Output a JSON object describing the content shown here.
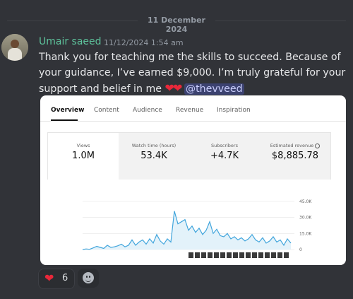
{
  "date_divider": "11 December 2024",
  "message": {
    "author": "Umair saeed",
    "timestamp": "11/12/2024 1:54 am",
    "text": "Thank you for teaching me the skills to succeed. Because of your guidance, I’ve earned $9,000. I’m truly grateful for your support and belief in me",
    "hearts": "❤❤",
    "mention": "@thevveed"
  },
  "analytics": {
    "tabs": [
      "Overview",
      "Content",
      "Audience",
      "Revenue",
      "Inspiration"
    ],
    "active_tab": "Overview",
    "metrics": [
      {
        "label": "Views",
        "value": "1.0M"
      },
      {
        "label": "Watch time (hours)",
        "value": "53.4K"
      },
      {
        "label": "Subscribers",
        "value": "+4.7K"
      },
      {
        "label": "Estimated revenue",
        "value": "$8,885.78"
      }
    ]
  },
  "chart_data": {
    "type": "area",
    "y_ticks": [
      "45.0K",
      "30.0K",
      "15.0K",
      "0"
    ],
    "ylim": [
      0,
      45000
    ],
    "values": [
      0,
      500,
      200,
      1500,
      3000,
      2000,
      1000,
      4000,
      2000,
      2500,
      3500,
      5000,
      2500,
      4000,
      9000,
      4000,
      7000,
      9000,
      5000,
      10000,
      6000,
      14000,
      8000,
      5000,
      10000,
      7000,
      36000,
      24000,
      26000,
      28000,
      18000,
      22000,
      16000,
      20000,
      14000,
      18000,
      26000,
      15000,
      19000,
      13000,
      12000,
      15000,
      10000,
      12000,
      9000,
      11000,
      8000,
      10000,
      14000,
      9000,
      7000,
      11000,
      6000,
      8000,
      12000,
      7000,
      9000,
      4000,
      10000,
      6000
    ],
    "color": "#41a5dc",
    "fill": "#e3f2fa",
    "timeline_count": 16
  },
  "reactions": [
    {
      "icon": "❤",
      "count": "6"
    }
  ]
}
